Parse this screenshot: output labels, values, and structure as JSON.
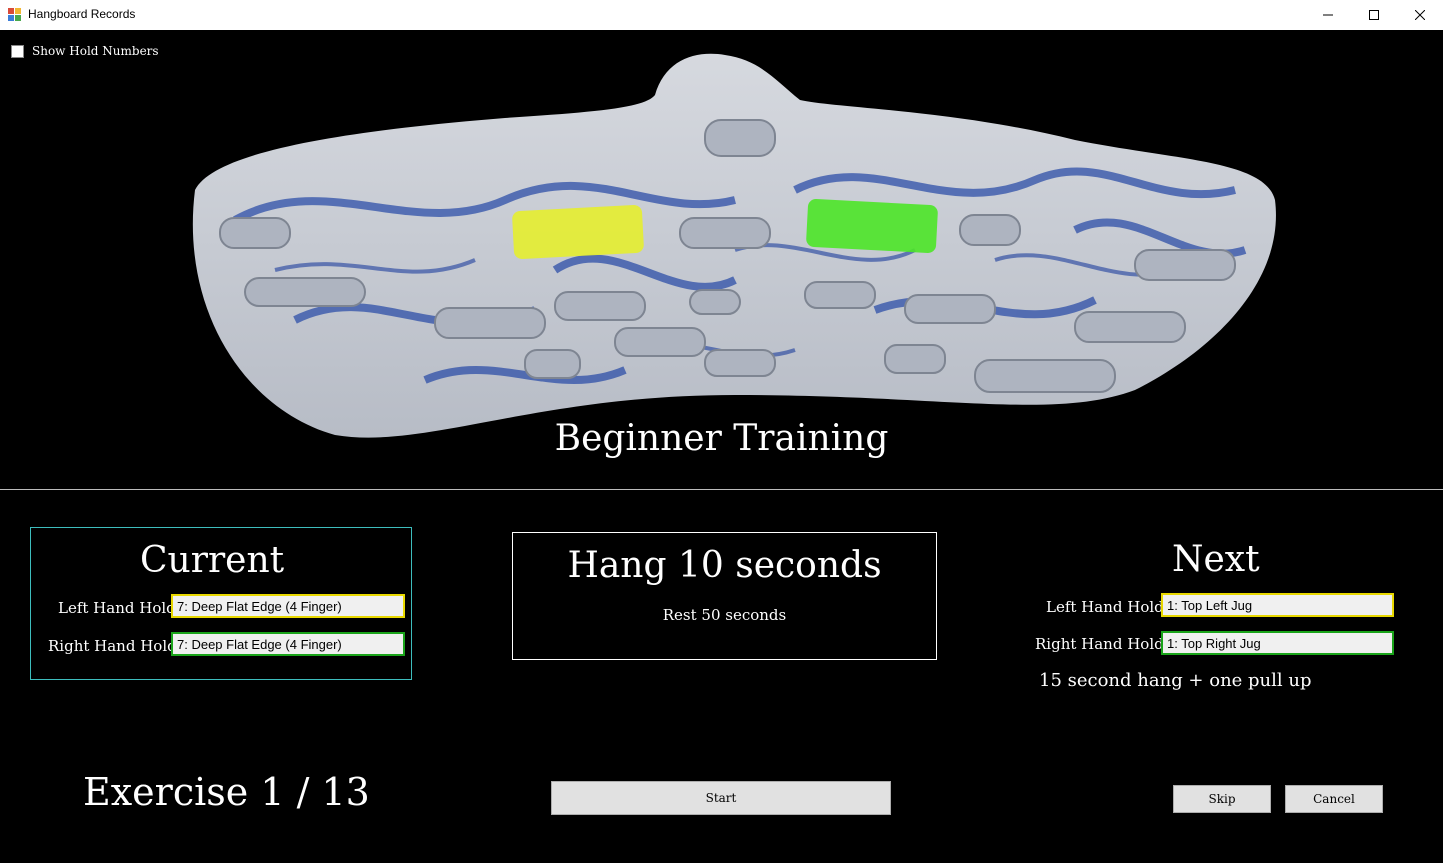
{
  "window": {
    "title": "Hangboard Records"
  },
  "options": {
    "show_hold_numbers_label": "Show Hold Numbers",
    "show_hold_numbers_checked": false
  },
  "board": {
    "left_highlight_color": "#e6ef2a",
    "right_highlight_color": "#4ce628"
  },
  "training_title": "Beginner Training",
  "current": {
    "heading": "Current",
    "left_label": "Left Hand Hold",
    "left_value": "7: Deep Flat Edge (4 Finger)",
    "right_label": "Right Hand Hold",
    "right_value": "7: Deep Flat Edge (4 Finger)"
  },
  "instruction": {
    "hang": "Hang 10 seconds",
    "rest": "Rest 50 seconds"
  },
  "next": {
    "heading": "Next",
    "left_label": "Left Hand Hold",
    "left_value": "1: Top Left Jug",
    "right_label": "Right Hand Hold",
    "right_value": "1: Top Right Jug",
    "note": "15 second hang + one pull up"
  },
  "exercise_counter": "Exercise 1 / 13",
  "buttons": {
    "start": "Start",
    "skip": "Skip",
    "cancel": "Cancel"
  },
  "colors": {
    "current_border": "#3dbdbd",
    "left_field_border": "#e8d800",
    "right_field_border": "#1aa41a"
  }
}
